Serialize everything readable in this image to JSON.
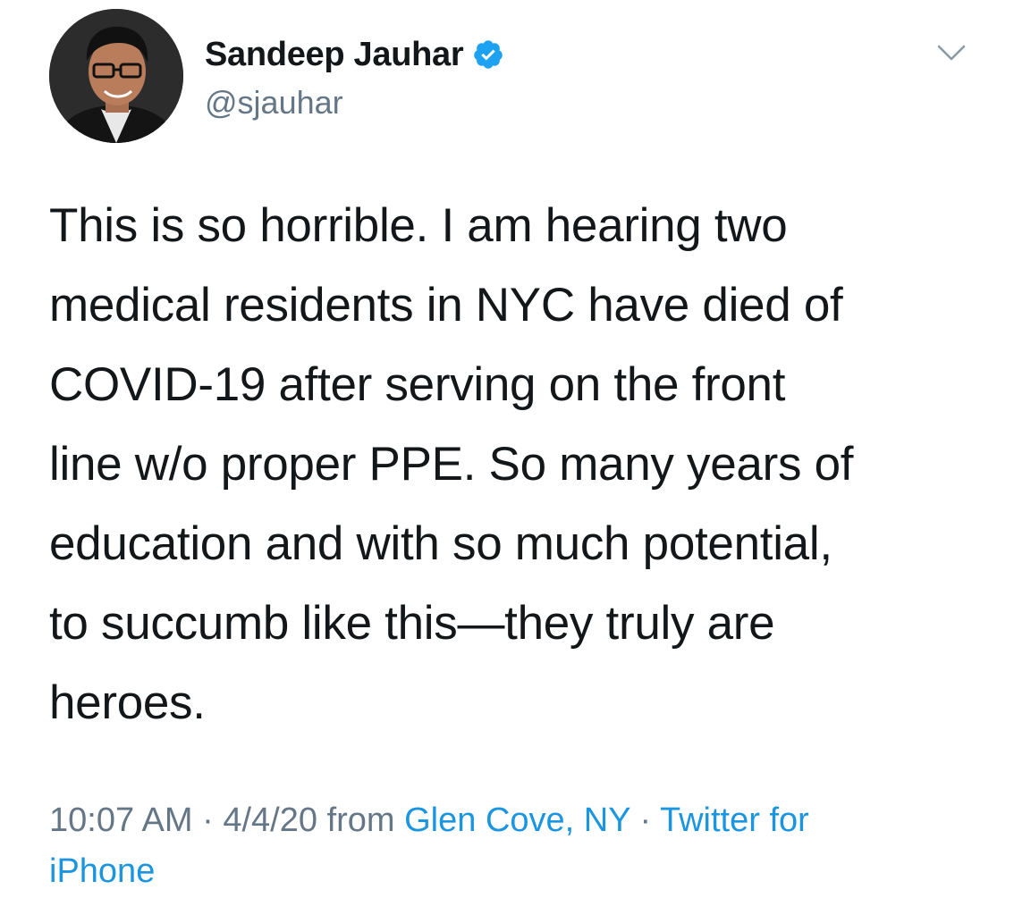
{
  "tweet": {
    "author": {
      "display_name": "Sandeep Jauhar",
      "handle": "@sjauhar",
      "verified": true,
      "avatar_icon": "profile-photo"
    },
    "menu_icon": "chevron-down-icon",
    "text_lines": [
      "This is so horrible. I am hearing two",
      "medical residents in NYC have died of",
      "COVID-19 after serving on the front",
      "line w/o proper PPE. So many years of",
      "education and with so much potential,",
      "to succumb like this—they truly are",
      "heroes."
    ],
    "meta": {
      "time": "10:07 AM",
      "separator": "·",
      "date": "4/4/20",
      "from_label": "from",
      "location": "Glen Cove, NY",
      "source_line1": "Twitter for",
      "source_line2": "iPhone"
    }
  },
  "colors": {
    "text": "#14171a",
    "secondary": "#657786",
    "link": "#1b95e0",
    "verified_badge": "#1da1f2"
  }
}
